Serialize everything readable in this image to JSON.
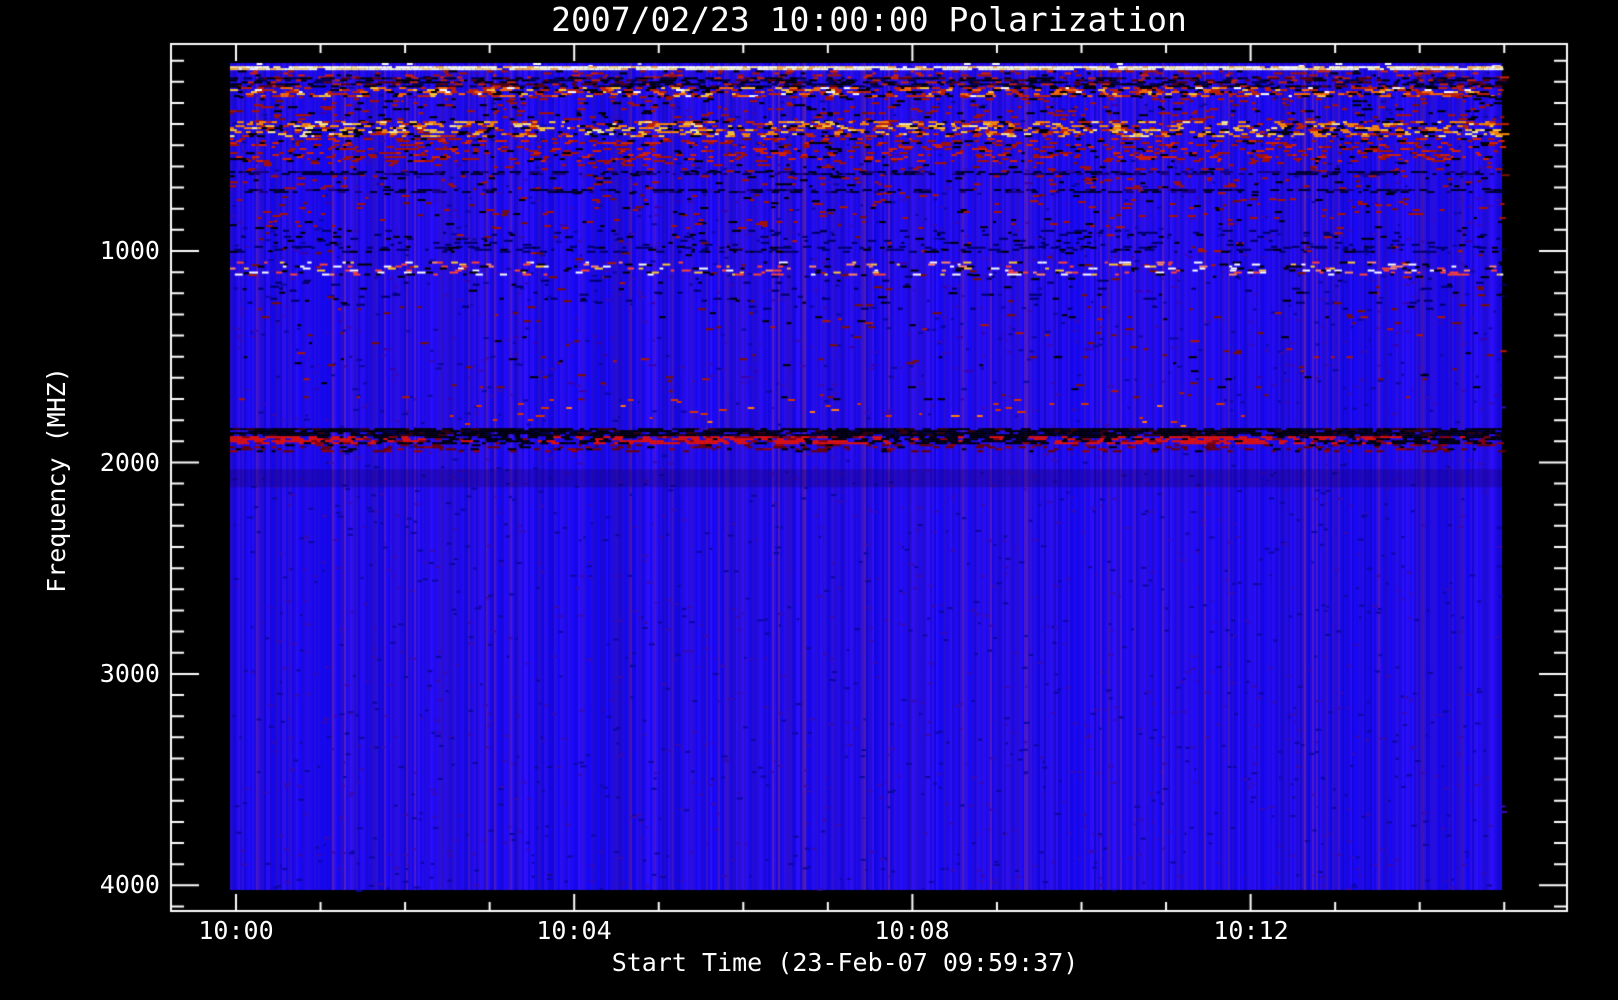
{
  "chart_data": {
    "type": "heatmap",
    "subtype": "radio-spectrogram",
    "title": "2007/02/23 10:00:00 Polarization",
    "xlabel": "Start Time (23-Feb-07 09:59:37)",
    "ylabel": "Frequency (MHZ)",
    "x_tick_labels": [
      "10:00",
      "10:04",
      "10:08",
      "10:12"
    ],
    "y_tick_labels": [
      "1000",
      "2000",
      "3000",
      "4000"
    ],
    "x_major_tick_interval_min": 4,
    "x_minor_tick_interval_min": 1,
    "y_major_tick_interval_mhz": 1000,
    "y_minor_tick_interval_mhz": 100,
    "x_start_time": "09:59:37",
    "x_span_minutes": 15,
    "y_range_mhz": [
      100,
      4100
    ],
    "y_axis_reversed": true,
    "grid": false,
    "legend": false,
    "frame_color": "#ffffff",
    "background_color": "#000000",
    "base_color": "#1f14e8",
    "styles": {
      "grain": {
        "colors": [
          "#7a1000",
          "#b01800",
          "#000000",
          "#3c00a8"
        ],
        "weights": [
          3,
          2,
          2,
          1
        ]
      },
      "white_sparse": {
        "colors": [
          "#ffffff",
          "#ccccff"
        ],
        "weights": [
          3,
          1
        ]
      },
      "cream_line": {
        "colors": [
          "#ffffd6",
          "#ffe289",
          "#ffb347",
          "#ffffff"
        ],
        "weights": [
          5,
          2,
          1,
          1
        ]
      },
      "red_light": {
        "colors": [
          "#a81200",
          "#d82200",
          "#000000"
        ],
        "weights": [
          3,
          2,
          1
        ]
      },
      "dark_heavy": {
        "colors": [
          "#000000",
          "#000044",
          "#5a0000",
          "#c42200"
        ],
        "weights": [
          4,
          2,
          2,
          1
        ]
      },
      "red_orange_heavy": {
        "colors": [
          "#c42200",
          "#ff6a00",
          "#ffc833",
          "#000000",
          "#ffffff"
        ],
        "weights": [
          6,
          4,
          2,
          4,
          1
        ]
      },
      "red_sparse": {
        "colors": [
          "#a81200",
          "#000000"
        ],
        "weights": [
          3,
          1
        ]
      },
      "orange_yellow_band": {
        "colors": [
          "#ff8800",
          "#ffc833",
          "#c42200",
          "#000000",
          "#ffee99"
        ],
        "weights": [
          3,
          2,
          2,
          2,
          1
        ]
      },
      "speckle_1100": {
        "colors": [
          "#ffffff",
          "#ff4433",
          "#ffc833",
          "#000000",
          "#ff8866"
        ],
        "weights": [
          2,
          2,
          1,
          2,
          1
        ]
      },
      "dark_dash_row": {
        "colors": [
          "#000066",
          "#000000"
        ],
        "weights": [
          3,
          1
        ]
      },
      "dark_line_soft": {
        "colors": [
          "#000033",
          "#1a0080"
        ],
        "weights": [
          2,
          1
        ]
      },
      "black_line": {
        "colors": [
          "#000000",
          "#000033",
          "#330000"
        ],
        "weights": [
          5,
          1,
          1
        ]
      },
      "black_red_mix": {
        "colors": [
          "#000000",
          "#e81100",
          "#8a0000"
        ],
        "weights": [
          3,
          3,
          1
        ]
      },
      "dark_red_row": {
        "colors": [
          "#6a0000",
          "#9a0000",
          "#000000"
        ],
        "weights": [
          3,
          1,
          1
        ]
      },
      "red_orange_sparse": {
        "colors": [
          "#d83300",
          "#ff7711"
        ],
        "weights": [
          2,
          1
        ]
      },
      "darker_blue": {
        "colors": [
          "rgba(30,0,90,0.30)"
        ],
        "weights": [
          1
        ],
        "overlay": true
      }
    },
    "bands": [
      {
        "f0": 268,
        "f1": 1700,
        "style": "grain",
        "density": 0.018
      },
      {
        "f0": 111,
        "f1": 126,
        "style": "white_sparse",
        "density": 0.04
      },
      {
        "f0": 126,
        "f1": 142,
        "style": "cream_line",
        "density": 0.92
      },
      {
        "f0": 146,
        "f1": 176,
        "style": "red_light",
        "density": 0.22
      },
      {
        "f0": 179,
        "f1": 221,
        "style": "dark_heavy",
        "density": 0.62
      },
      {
        "f0": 225,
        "f1": 264,
        "style": "red_orange_heavy",
        "density": 0.5
      },
      {
        "f0": 268,
        "f1": 382,
        "style": "red_sparse",
        "density": 0.12
      },
      {
        "f0": 386,
        "f1": 461,
        "style": "orange_yellow_band",
        "density": 0.48
      },
      {
        "f0": 466,
        "f1": 576,
        "style": "red_light",
        "density": 0.26
      },
      {
        "f0": 580,
        "f1": 618,
        "style": "red_sparse",
        "density": 0.1
      },
      {
        "f0": 622,
        "f1": 637,
        "style": "dark_line_soft",
        "density": 0.55
      },
      {
        "f0": 642,
        "f1": 702,
        "style": "red_sparse",
        "density": 0.08
      },
      {
        "f0": 707,
        "f1": 721,
        "style": "dark_line_soft",
        "density": 0.45
      },
      {
        "f0": 726,
        "f1": 896,
        "style": "red_sparse",
        "density": 0.05
      },
      {
        "f0": 900,
        "f1": 976,
        "style": "dark_dash_row",
        "density": 0.1
      },
      {
        "f0": 980,
        "f1": 1000,
        "style": "dark_dash_row",
        "density": 0.28
      },
      {
        "f0": 1050,
        "f1": 1113,
        "style": "speckle_1100",
        "density": 0.2
      },
      {
        "f0": 1117,
        "f1": 1270,
        "style": "dark_dash_row",
        "density": 0.04
      },
      {
        "f0": 1700,
        "f1": 1830,
        "style": "red_orange_sparse",
        "density": 0.03,
        "x0": 0.15,
        "x1": 0.8
      },
      {
        "f0": 1838,
        "f1": 1872,
        "style": "black_line",
        "density": 0.85
      },
      {
        "f0": 1876,
        "f1": 1910,
        "style": "black_red_mix",
        "density": 0.72
      },
      {
        "f0": 1914,
        "f1": 1946,
        "style": "dark_red_row",
        "density": 0.28
      },
      {
        "f0": 2032,
        "f1": 2112,
        "style": "darker_blue",
        "density": 1.0
      }
    ]
  }
}
